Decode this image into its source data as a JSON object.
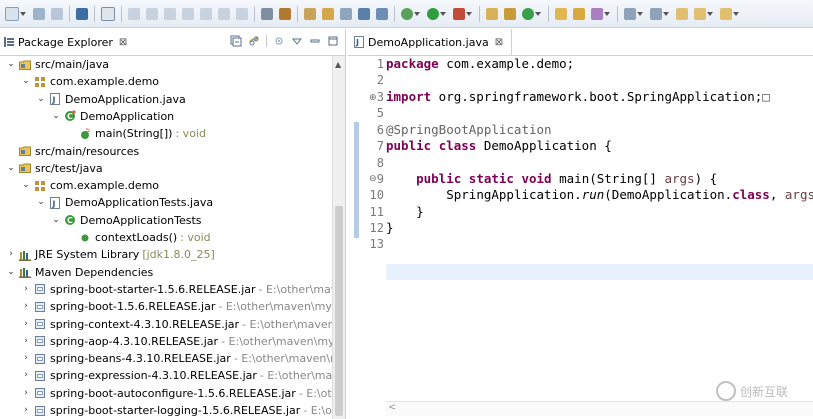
{
  "left_panel": {
    "title": "Package Explorer",
    "close": "⊠"
  },
  "tree": [
    {
      "label": "src/main/java",
      "suffix": "",
      "suffix_type": "",
      "depth": 0,
      "twisty": "⌄",
      "icon": "source-folder-icon"
    },
    {
      "label": "com.example.demo",
      "suffix": "",
      "suffix_type": "",
      "depth": 1,
      "twisty": "⌄",
      "icon": "package-icon"
    },
    {
      "label": "DemoApplication.java",
      "suffix": "",
      "suffix_type": "",
      "depth": 2,
      "twisty": "⌄",
      "icon": "java-file-icon"
    },
    {
      "label": "DemoApplication",
      "suffix": "",
      "suffix_type": "",
      "depth": 3,
      "twisty": "⌄",
      "icon": "class-icon"
    },
    {
      "label": "main(String[])",
      "suffix": ": void",
      "suffix_type": "dim",
      "depth": 4,
      "twisty": "",
      "icon": "static-method-icon"
    },
    {
      "label": "src/main/resources",
      "suffix": "",
      "suffix_type": "",
      "depth": 0,
      "twisty": "",
      "icon": "source-folder-icon"
    },
    {
      "label": "src/test/java",
      "suffix": "",
      "suffix_type": "",
      "depth": 0,
      "twisty": "⌄",
      "icon": "source-folder-icon"
    },
    {
      "label": "com.example.demo",
      "suffix": "",
      "suffix_type": "",
      "depth": 1,
      "twisty": "⌄",
      "icon": "package-icon"
    },
    {
      "label": "DemoApplicationTests.java",
      "suffix": "",
      "suffix_type": "",
      "depth": 2,
      "twisty": "⌄",
      "icon": "java-file-icon"
    },
    {
      "label": "DemoApplicationTests",
      "suffix": "",
      "suffix_type": "",
      "depth": 3,
      "twisty": "⌄",
      "icon": "test-class-icon"
    },
    {
      "label": "contextLoads()",
      "suffix": ": void",
      "suffix_type": "dim",
      "depth": 4,
      "twisty": "",
      "icon": "method-icon"
    },
    {
      "label": "JRE System Library",
      "suffix": "[jdk1.8.0_25]",
      "suffix_type": "dim",
      "depth": 0,
      "twisty": "›",
      "icon": "library-icon"
    },
    {
      "label": "Maven Dependencies",
      "suffix": "",
      "suffix_type": "",
      "depth": 0,
      "twisty": "⌄",
      "icon": "library-icon"
    },
    {
      "label": "spring-boot-starter-1.5.6.RELEASE.jar",
      "suffix": "- E:\\other\\maven\\my_",
      "suffix_type": "path",
      "depth": 1,
      "twisty": "›",
      "icon": "jar-icon"
    },
    {
      "label": "spring-boot-1.5.6.RELEASE.jar",
      "suffix": "- E:\\other\\maven\\my_local_r",
      "suffix_type": "path",
      "depth": 1,
      "twisty": "›",
      "icon": "jar-icon"
    },
    {
      "label": "spring-context-4.3.10.RELEASE.jar",
      "suffix": "- E:\\other\\maven\\my_loc",
      "suffix_type": "path",
      "depth": 1,
      "twisty": "›",
      "icon": "jar-icon"
    },
    {
      "label": "spring-aop-4.3.10.RELEASE.jar",
      "suffix": "- E:\\other\\maven\\my_local_r",
      "suffix_type": "path",
      "depth": 1,
      "twisty": "›",
      "icon": "jar-icon"
    },
    {
      "label": "spring-beans-4.3.10.RELEASE.jar",
      "suffix": "- E:\\other\\maven\\my_loca",
      "suffix_type": "path",
      "depth": 1,
      "twisty": "›",
      "icon": "jar-icon"
    },
    {
      "label": "spring-expression-4.3.10.RELEASE.jar",
      "suffix": "- E:\\other\\maven\\my_",
      "suffix_type": "path",
      "depth": 1,
      "twisty": "›",
      "icon": "jar-icon"
    },
    {
      "label": "spring-boot-autoconfigure-1.5.6.RELEASE.jar",
      "suffix": "- E:\\other\\ma",
      "suffix_type": "path",
      "depth": 1,
      "twisty": "›",
      "icon": "jar-icon"
    },
    {
      "label": "spring-boot-starter-logging-1.5.6.RELEASE.jar",
      "suffix": "- E:\\other\\ma",
      "suffix_type": "path",
      "depth": 1,
      "twisty": "›",
      "icon": "jar-icon"
    }
  ],
  "editor": {
    "tab_title": "DemoApplication.java",
    "close": "⊠",
    "line_numbers": [
      "1",
      "2",
      "3",
      "5",
      "6",
      "7",
      "8",
      "9",
      "10",
      "11",
      "12",
      "13"
    ],
    "fold_markers": [
      "⊕",
      "⊖"
    ],
    "code": {
      "l1_kw": "package",
      "l1_rest": " com.example.demo;",
      "l3_kw": "import",
      "l3_rest": " org.springframework.boot.SpringApplication;",
      "l3_box": "□",
      "l6_ann": "@SpringBootApplication",
      "l7_kw1": "public",
      "l7_kw2": "class",
      "l7_rest": " DemoApplication {",
      "l9_kw1": "public",
      "l9_kw2": "static",
      "l9_kw3": "void",
      "l9_name": " main(String[] ",
      "l9_param": "args",
      "l9_end": ") {",
      "l10_a": "SpringApplication.",
      "l10_run": "run",
      "l10_b": "(DemoApplication.",
      "l10_kw": "class",
      "l10_c": ", ",
      "l10_param": "args",
      "l10_d": ");",
      "l11": "}",
      "l12": "}"
    },
    "hscroll_arrow": "<"
  },
  "watermark": {
    "text": "创新互联"
  },
  "colors": {
    "keyword": "#7f0055",
    "annotation": "#646464",
    "parameter": "#6a3e3e",
    "current_line": "#e8f2fe"
  }
}
